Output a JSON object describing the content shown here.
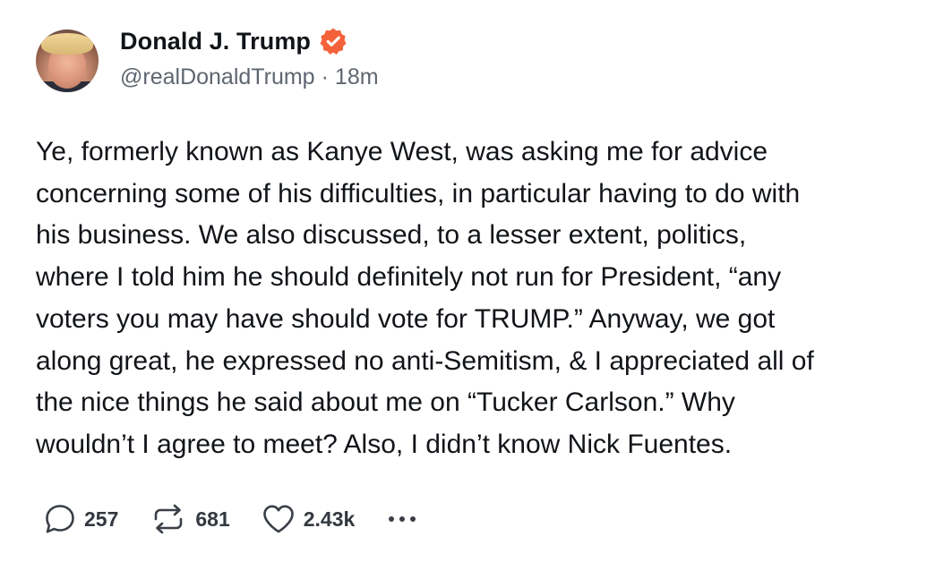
{
  "post": {
    "author": {
      "display_name": "Donald J. Trump",
      "handle": "@realDonaldTrump",
      "verified": true,
      "verified_color": "#f4623a"
    },
    "separator": "·",
    "timestamp": "18m",
    "text": "Ye, formerly known as Kanye West, was asking me for advice\nconcerning some of his difficulties, in particular having to do with\nhis business. We also discussed, to a lesser extent, politics,\nwhere I told him he should definitely not run for President, “any\nvoters you may have should vote for TRUMP.” Anyway, we got\nalong great, he expressed no anti-Semitism, & I appreciated all of\nthe nice things he said about me on “Tucker Carlson.” Why\nwouldn’t I agree to meet? Also, I didn’t know Nick Fuentes.",
    "actions": {
      "replies": "257",
      "reposts": "681",
      "likes": "2.43k",
      "reply_icon": "speech-bubble-icon",
      "repost_icon": "repost-arrows-icon",
      "like_icon": "heart-icon",
      "more_icon": "more-dots-icon"
    }
  }
}
